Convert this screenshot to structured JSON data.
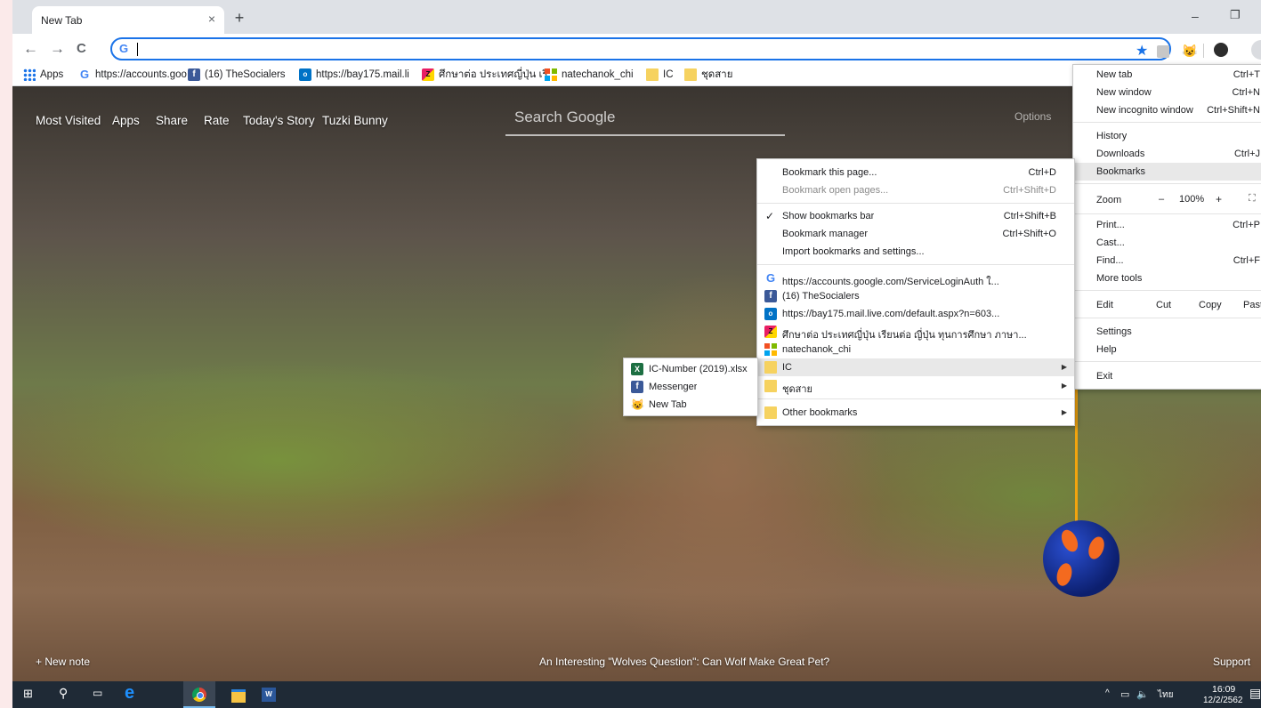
{
  "tab": {
    "title": "New Tab",
    "close": "×",
    "new": "+"
  },
  "window": {
    "minimize": "–",
    "maximize": "❐",
    "close": "✕"
  },
  "toolbar": {
    "back": "←",
    "forward": "→",
    "reload": "C",
    "omnibox_value": "",
    "omnibox_icon": "G"
  },
  "bookmarks_bar": [
    {
      "label": "Apps",
      "icon": "apps-grid-icon"
    },
    {
      "label": "https://accounts.goo",
      "icon": "google-icon"
    },
    {
      "label": "(16) TheSocialers",
      "icon": "facebook-icon"
    },
    {
      "label": "https://bay175.mail.li",
      "icon": "outlook-icon"
    },
    {
      "label": "ศึกษาต่อ ประเทศญี่ปุ่น เรี",
      "icon": "sz-icon"
    },
    {
      "label": "natechanok_chi",
      "icon": "microsoft-icon"
    },
    {
      "label": "IC",
      "icon": "folder-icon"
    },
    {
      "label": "ชุดสาย",
      "icon": "folder-icon"
    }
  ],
  "ntp": {
    "links": [
      "Most Visited",
      "Apps",
      "Share",
      "Rate",
      "Today's Story",
      "Tuzki Bunny"
    ],
    "search_placeholder": "Search Google",
    "options": "Options",
    "new_note": "+ New note",
    "story": "An Interesting \"Wolves Question\": Can Wolf Make Great Pet?",
    "support": "Support"
  },
  "chrome_menu": {
    "new_tab": "New tab",
    "new_tab_sc": "Ctrl+T",
    "new_window": "New window",
    "new_window_sc": "Ctrl+N",
    "incognito": "New incognito window",
    "incognito_sc": "Ctrl+Shift+N",
    "history": "History",
    "downloads": "Downloads",
    "downloads_sc": "Ctrl+J",
    "bookmarks": "Bookmarks",
    "zoom": "Zoom",
    "zoom_minus": "–",
    "zoom_value": "100%",
    "zoom_plus": "+",
    "print": "Print...",
    "print_sc": "Ctrl+P",
    "cast": "Cast...",
    "find": "Find...",
    "find_sc": "Ctrl+F",
    "more_tools": "More tools",
    "edit": "Edit",
    "cut": "Cut",
    "copy": "Copy",
    "paste": "Past",
    "settings": "Settings",
    "help": "Help",
    "exit": "Exit"
  },
  "bookmarks_menu": {
    "bookmark_page": "Bookmark this page...",
    "bookmark_page_sc": "Ctrl+D",
    "bookmark_open": "Bookmark open pages...",
    "bookmark_open_sc": "Ctrl+Shift+D",
    "show_bar": "Show bookmarks bar",
    "show_bar_sc": "Ctrl+Shift+B",
    "show_bar_check": "✓",
    "manager": "Bookmark manager",
    "manager_sc": "Ctrl+Shift+O",
    "import": "Import bookmarks and settings...",
    "items": [
      {
        "label": "https://accounts.google.com/ServiceLoginAuth ใ...",
        "icon": "google-icon"
      },
      {
        "label": "(16) TheSocialers",
        "icon": "facebook-icon"
      },
      {
        "label": "https://bay175.mail.live.com/default.aspx?n=603...",
        "icon": "outlook-icon"
      },
      {
        "label": "ศึกษาต่อ ประเทศญี่ปุ่น เรียนต่อ ญี่ปุ่น ทุนการศึกษา ภาษา...",
        "icon": "sz-icon"
      },
      {
        "label": "natechanok_chi",
        "icon": "microsoft-icon"
      }
    ],
    "folder_ic": "IC",
    "folder_chudsai": "ชุดสาย",
    "other": "Other bookmarks"
  },
  "ic_menu": [
    {
      "label": "IC-Number (2019).xlsx",
      "icon": "excel-icon"
    },
    {
      "label": "Messenger",
      "icon": "facebook-icon"
    },
    {
      "label": "New Tab",
      "icon": "cat-icon"
    }
  ],
  "taskbar": {
    "tray_lang": "ไทย",
    "time": "16:09",
    "date": "12/2/2562"
  }
}
